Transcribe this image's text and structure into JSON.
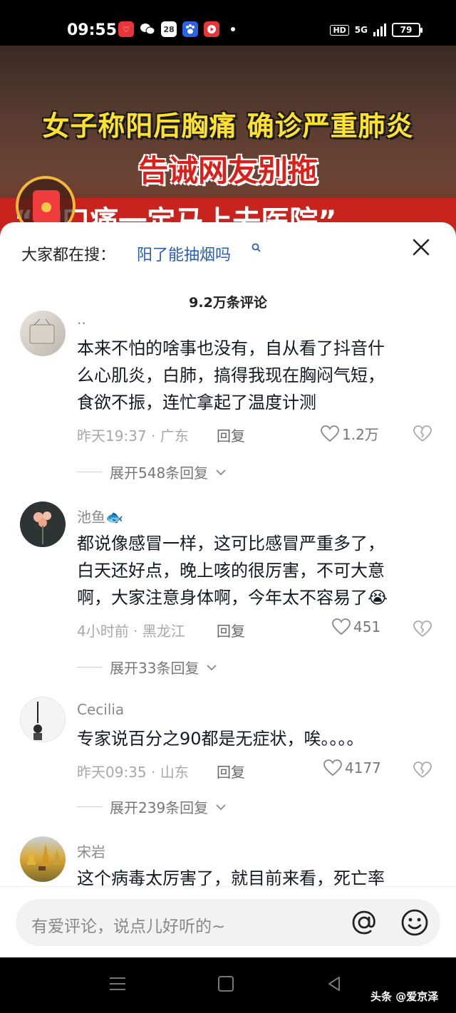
{
  "status_bar": {
    "time": "09:55",
    "app_icons": [
      "app-icon-red",
      "wechat-icon",
      "calendar-icon",
      "baidu-icon",
      "video-app-icon"
    ],
    "calendar_day": "28",
    "hd": "HD",
    "network": "5G",
    "battery": "79"
  },
  "video": {
    "headline_1": "女子称阳后胸痛 确诊严重肺炎",
    "headline_2": "告诫网友别拖",
    "banner_text": "“胸口痛一定马上去医院”",
    "colors": {
      "headline_1": "#ffe12e",
      "headline_2": "#d9201b",
      "banner": "#c8231d"
    }
  },
  "sheet": {
    "search_hint": "大家都在搜：",
    "search_link": "阳了能抽烟吗",
    "comment_count": "9.2万条评论"
  },
  "comments": [
    {
      "name": "..",
      "text": [
        "本来不怕的啥事也没有，自从看了抖音什",
        "么心肌炎，白肺，搞得我现在胸闷气短，",
        "食欲不振，连忙拿起了温度计测"
      ],
      "meta": "昨天19:37 · 广东",
      "reply": "回复",
      "likes": "1.2万",
      "expand": "展开548条回复"
    },
    {
      "name": "池鱼",
      "name_emoji": "🐟",
      "text": [
        "都说像感冒一样，这可比感冒严重多了，",
        "白天还好点，晚上咳的很厉害，不可大意",
        "啊，大家注意身体啊，今年太不容易了😭"
      ],
      "meta": "4小时前 · 黑龙江",
      "reply": "回复",
      "likes": "451",
      "expand": "展开33条回复"
    },
    {
      "name": "Cecilia",
      "text": [
        "专家说百分之90都是无症状，唉。。。。"
      ],
      "meta": "昨天09:35 · 山东",
      "reply": "回复",
      "likes": "4177",
      "expand": "展开239条回复"
    },
    {
      "name": "宋岩",
      "text": [
        "这个病毒太厉害了，就目前来看，死亡率"
      ]
    }
  ],
  "input": {
    "placeholder": "有爱评论，说点儿好听的~"
  },
  "watermark": "头条 @爱京泽"
}
